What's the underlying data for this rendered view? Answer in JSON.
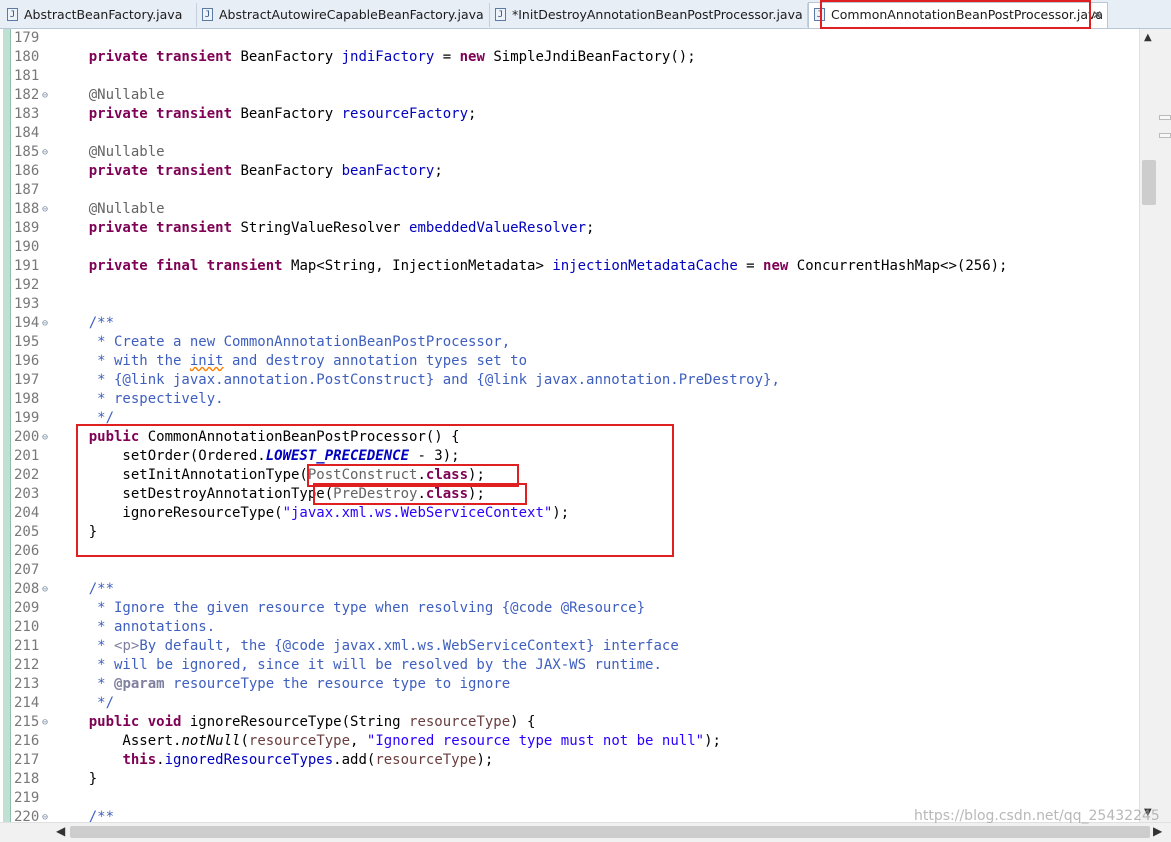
{
  "tabs": [
    {
      "label": "AbstractBeanFactory.java",
      "icon": "java-file-icon"
    },
    {
      "label": "AbstractAutowireCapableBeanFactory.java",
      "icon": "java-file-icon"
    },
    {
      "label": "*InitDestroyAnnotationBeanPostProcessor.java",
      "icon": "java-file-icon"
    },
    {
      "label": "CommonAnnotationBeanPostProcessor.java",
      "icon": "java-file-icon",
      "active": true,
      "close": "✕"
    }
  ],
  "code_lines": [
    {
      "n": "179",
      "html": ""
    },
    {
      "n": "180",
      "html": "    <span class=\"kw\">private transient</span> BeanFactory <span class=\"fld\">jndiFactory</span> = <span class=\"kw\">new</span> SimpleJndiBeanFactory();"
    },
    {
      "n": "181",
      "html": ""
    },
    {
      "n": "182",
      "fold": true,
      "html": "    <span class=\"ann\">@Nullable</span>"
    },
    {
      "n": "183",
      "html": "    <span class=\"kw\">private transient</span> BeanFactory <span class=\"fld\">resourceFactory</span>;"
    },
    {
      "n": "184",
      "html": ""
    },
    {
      "n": "185",
      "fold": true,
      "html": "    <span class=\"ann\">@Nullable</span>"
    },
    {
      "n": "186",
      "html": "    <span class=\"kw\">private transient</span> BeanFactory <span class=\"fld\">beanFactory</span>;"
    },
    {
      "n": "187",
      "html": ""
    },
    {
      "n": "188",
      "fold": true,
      "html": "    <span class=\"ann\">@Nullable</span>"
    },
    {
      "n": "189",
      "html": "    <span class=\"kw\">private transient</span> StringValueResolver <span class=\"fld\">embeddedValueResolver</span>;"
    },
    {
      "n": "190",
      "html": ""
    },
    {
      "n": "191",
      "html": "    <span class=\"kw\">private final transient</span> Map&lt;String, InjectionMetadata&gt; <span class=\"fld\">injectionMetadataCache</span> = <span class=\"kw\">new</span> ConcurrentHashMap&lt;&gt;(256);"
    },
    {
      "n": "192",
      "html": ""
    },
    {
      "n": "193",
      "html": ""
    },
    {
      "n": "194",
      "fold": true,
      "html": "    <span class=\"cmt\">/**</span>"
    },
    {
      "n": "195",
      "html": "<span class=\"cmt\">     * Create a new CommonAnnotationBeanPostProcessor,</span>"
    },
    {
      "n": "196",
      "html": "<span class=\"cmt\">     * with the <span class=\"sq\">init</span> and destroy annotation types set to</span>"
    },
    {
      "n": "197",
      "html": "<span class=\"cmt\">     * {@link javax.annotation.PostConstruct} and {@link javax.annotation.PreDestroy},</span>"
    },
    {
      "n": "198",
      "html": "<span class=\"cmt\">     * respectively.</span>"
    },
    {
      "n": "199",
      "html": "<span class=\"cmt\">     */</span>"
    },
    {
      "n": "200",
      "fold": true,
      "html": "    <span class=\"kw\">public</span> CommonAnnotationBeanPostProcessor() {"
    },
    {
      "n": "201",
      "html": "        setOrder(Ordered.<span class=\"stat\">LOWEST_PRECEDENCE</span> - 3);"
    },
    {
      "n": "202",
      "html": "        setInitAnnotationType(<span class=\"gray\">PostConstruct</span>.<span class=\"kw\">class</span>);"
    },
    {
      "n": "203",
      "html": "        setDestroyAnnotationType(<span class=\"gray\">PreDestroy</span>.<span class=\"kw\">class</span>);"
    },
    {
      "n": "204",
      "html": "        ignoreResourceType(<span class=\"str\">\"javax.xml.ws.WebServiceContext\"</span>);"
    },
    {
      "n": "205",
      "html": "    }"
    },
    {
      "n": "206",
      "html": ""
    },
    {
      "n": "207",
      "html": ""
    },
    {
      "n": "208",
      "fold": true,
      "html": "    <span class=\"cmt\">/**</span>"
    },
    {
      "n": "209",
      "html": "<span class=\"cmt\">     * Ignore the given resource type when resolving {@code @Resource}</span>"
    },
    {
      "n": "210",
      "html": "<span class=\"cmt\">     * annotations.</span>"
    },
    {
      "n": "211",
      "html": "<span class=\"cmt\">     * <span class=\"tagc\">&lt;p&gt;</span>By default, the {@code javax.xml.ws.WebServiceContext} interface</span>"
    },
    {
      "n": "212",
      "html": "<span class=\"cmt\">     * will be ignored, since it will be resolved by the JAX-WS runtime.</span>"
    },
    {
      "n": "213",
      "html": "<span class=\"cmt\">     * <span class=\"tagc\" style=\"font-weight:bold\">@param</span> resourceType the resource type to ignore</span>"
    },
    {
      "n": "214",
      "html": "<span class=\"cmt\">     */</span>"
    },
    {
      "n": "215",
      "fold": true,
      "html": "    <span class=\"kw\">public void</span> ignoreResourceType(String <span class=\"fld\" style=\"color:#6a3e3e\">resourceType</span>) {"
    },
    {
      "n": "216",
      "html": "        Assert.<span class=\"it\">notNull</span>(<span style=\"color:#6a3e3e\">resourceType</span>, <span class=\"str\">\"Ignored resource type must not be null\"</span>);"
    },
    {
      "n": "217",
      "html": "        <span class=\"kw\">this</span>.<span class=\"fld\">ignoredResourceTypes</span>.add(<span style=\"color:#6a3e3e\">resourceType</span>);"
    },
    {
      "n": "218",
      "html": "    }"
    },
    {
      "n": "219",
      "html": ""
    },
    {
      "n": "220",
      "fold": true,
      "html": "    <span class=\"cmt\">/**</span>"
    }
  ],
  "scroll": {
    "up": "▲",
    "down": "▼",
    "left": "◀",
    "right": "▶"
  },
  "watermark": "https://blog.csdn.net/qq_25432245"
}
